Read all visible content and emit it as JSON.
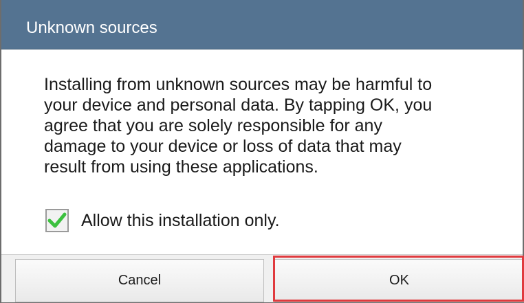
{
  "dialog": {
    "title": "Unknown sources",
    "message_lines": [
      "Installing from unknown sources may be harmful to",
      "your device and personal data. By tapping OK, you",
      "agree that you are solely responsible for any",
      "damage to your device or loss of data that may",
      "result from using these applications."
    ],
    "checkbox": {
      "label": "Allow this installation only.",
      "checked": true
    },
    "buttons": {
      "cancel_label": "Cancel",
      "ok_label": "OK"
    }
  },
  "colors": {
    "title_bar": "#547391",
    "check_mark": "#3cc13f",
    "highlight": "#e03a3e"
  },
  "icons": {
    "checkbox": "check-icon"
  }
}
